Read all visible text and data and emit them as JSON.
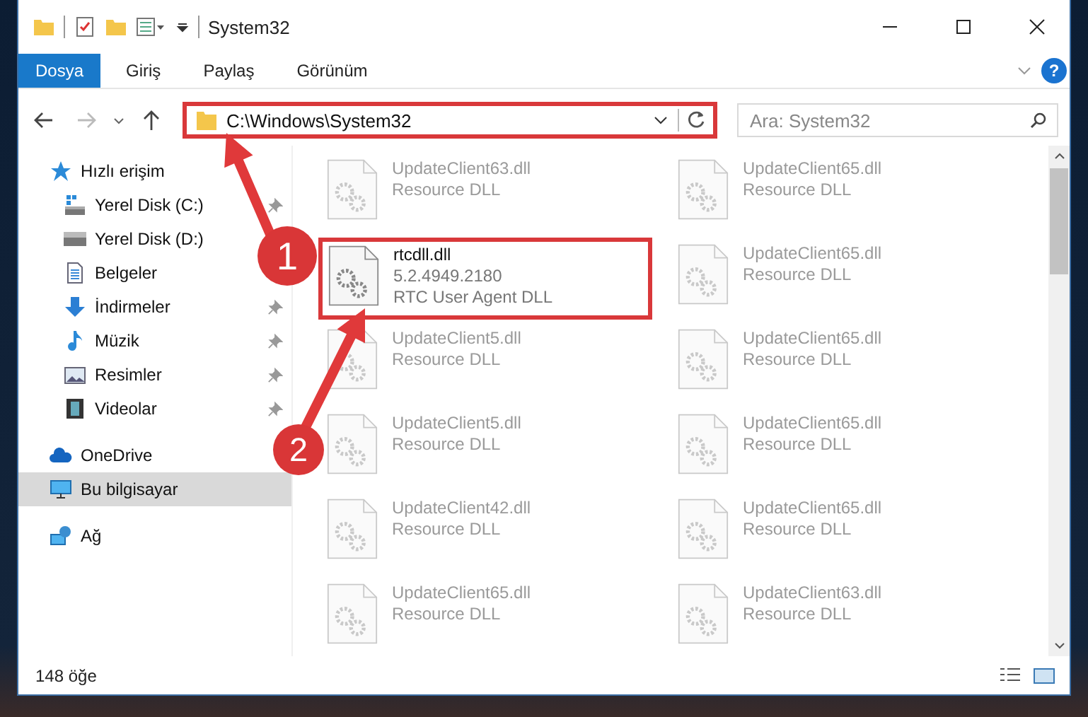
{
  "window": {
    "title": "System32"
  },
  "ribbon_tabs": [
    {
      "label": "Dosya",
      "selected": true
    },
    {
      "label": "Giriş",
      "selected": false
    },
    {
      "label": "Paylaş",
      "selected": false
    },
    {
      "label": "Görünüm",
      "selected": false
    }
  ],
  "help_button": {
    "label": "?"
  },
  "address_bar": {
    "value": "C:\\Windows\\System32",
    "highlighted": true
  },
  "search": {
    "placeholder": "Ara: System32"
  },
  "sidebar": {
    "items": [
      {
        "label": "Hızlı erişim",
        "kind": "star",
        "selected": false,
        "children": [
          {
            "label": "Yerel Disk (C:)",
            "kind": "disk-c",
            "pinned": true,
            "selected": false
          },
          {
            "label": "Yerel Disk (D:)",
            "kind": "disk",
            "pinned": false,
            "selected": false
          },
          {
            "label": "Belgeler",
            "kind": "docs",
            "pinned": false,
            "selected": false
          },
          {
            "label": "İndirmeler",
            "kind": "download",
            "pinned": true,
            "selected": false
          },
          {
            "label": "Müzik",
            "kind": "music",
            "pinned": true,
            "selected": false
          },
          {
            "label": "Resimler",
            "kind": "pictures",
            "pinned": true,
            "selected": false
          },
          {
            "label": "Videolar",
            "kind": "videos",
            "pinned": true,
            "selected": false
          }
        ]
      },
      {
        "label": "OneDrive",
        "kind": "cloud",
        "selected": false
      },
      {
        "label": "Bu bilgisayar",
        "kind": "pc",
        "selected": true
      },
      {
        "label": "Ağ",
        "kind": "network",
        "selected": false
      }
    ]
  },
  "files": [
    {
      "name": "UpdateClient63.dll",
      "lines": [
        "Resource DLL"
      ],
      "dimmed": true,
      "highlighted": false
    },
    {
      "name": "UpdateClient65.dll",
      "lines": [
        "Resource DLL"
      ],
      "dimmed": true,
      "highlighted": false
    },
    {
      "name": "rtcdll.dll",
      "lines": [
        "5.2.4949.2180",
        "RTC User Agent DLL"
      ],
      "dimmed": false,
      "highlighted": true
    },
    {
      "name": "UpdateClient65.dll",
      "lines": [
        "Resource DLL"
      ],
      "dimmed": true,
      "highlighted": false
    },
    {
      "name": "UpdateClient5.dll",
      "lines": [
        "Resource DLL"
      ],
      "dimmed": true,
      "highlighted": false
    },
    {
      "name": "UpdateClient65.dll",
      "lines": [
        "Resource DLL"
      ],
      "dimmed": true,
      "highlighted": false
    },
    {
      "name": "UpdateClient5.dll",
      "lines": [
        "Resource DLL"
      ],
      "dimmed": true,
      "highlighted": false
    },
    {
      "name": "UpdateClient65.dll",
      "lines": [
        "Resource DLL"
      ],
      "dimmed": true,
      "highlighted": false
    },
    {
      "name": "UpdateClient42.dll",
      "lines": [
        "Resource DLL"
      ],
      "dimmed": true,
      "highlighted": false
    },
    {
      "name": "UpdateClient65.dll",
      "lines": [
        "Resource DLL"
      ],
      "dimmed": true,
      "highlighted": false
    },
    {
      "name": "UpdateClient65.dll",
      "lines": [
        "Resource DLL"
      ],
      "dimmed": true,
      "highlighted": false
    },
    {
      "name": "UpdateClient63.dll",
      "lines": [
        "Resource DLL"
      ],
      "dimmed": true,
      "highlighted": false
    }
  ],
  "status_bar": {
    "item_count": "148 öğe"
  },
  "annotations": [
    {
      "number": "1"
    },
    {
      "number": "2"
    }
  ]
}
